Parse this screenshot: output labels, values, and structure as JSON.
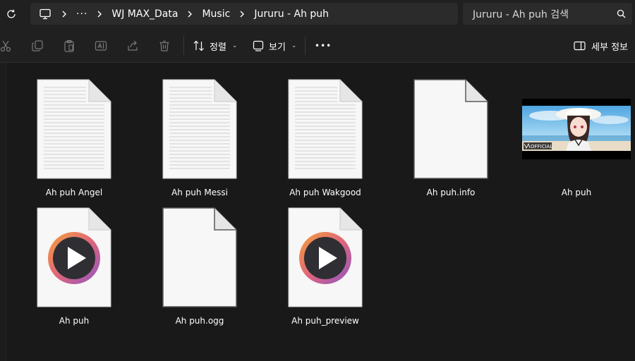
{
  "address_bar": {
    "overflow_glyph": "···",
    "breadcrumbs": [
      "WJ MAX_Data",
      "Music",
      "Jururu - Ah puh"
    ]
  },
  "search": {
    "placeholder": "Jururu - Ah puh 검색"
  },
  "toolbar": {
    "sort_label": "정렬",
    "view_label": "보기",
    "more_glyph": "•••",
    "details_label": "세부 정보"
  },
  "video_thumbnail": {
    "official_text": "OFFICIAL"
  },
  "files": [
    {
      "name": "Ah puh Angel",
      "icon": "text-document-icon"
    },
    {
      "name": "Ah puh Messi",
      "icon": "text-document-icon"
    },
    {
      "name": "Ah puh Wakgood",
      "icon": "text-document-icon"
    },
    {
      "name": "Ah puh.info",
      "icon": "blank-document-icon"
    },
    {
      "name": "Ah puh",
      "icon": "image-thumbnail-icon"
    },
    {
      "name": "Ah puh",
      "icon": "media-player-icon"
    },
    {
      "name": "Ah puh.ogg",
      "icon": "blank-document-icon"
    },
    {
      "name": "Ah puh_preview",
      "icon": "media-player-icon"
    }
  ],
  "colors": {
    "background": "#191919",
    "toolbar": "#202020",
    "field": "#2b2b2b",
    "media_ring_start": "#f08a3c",
    "media_ring_end": "#8e56c6"
  }
}
